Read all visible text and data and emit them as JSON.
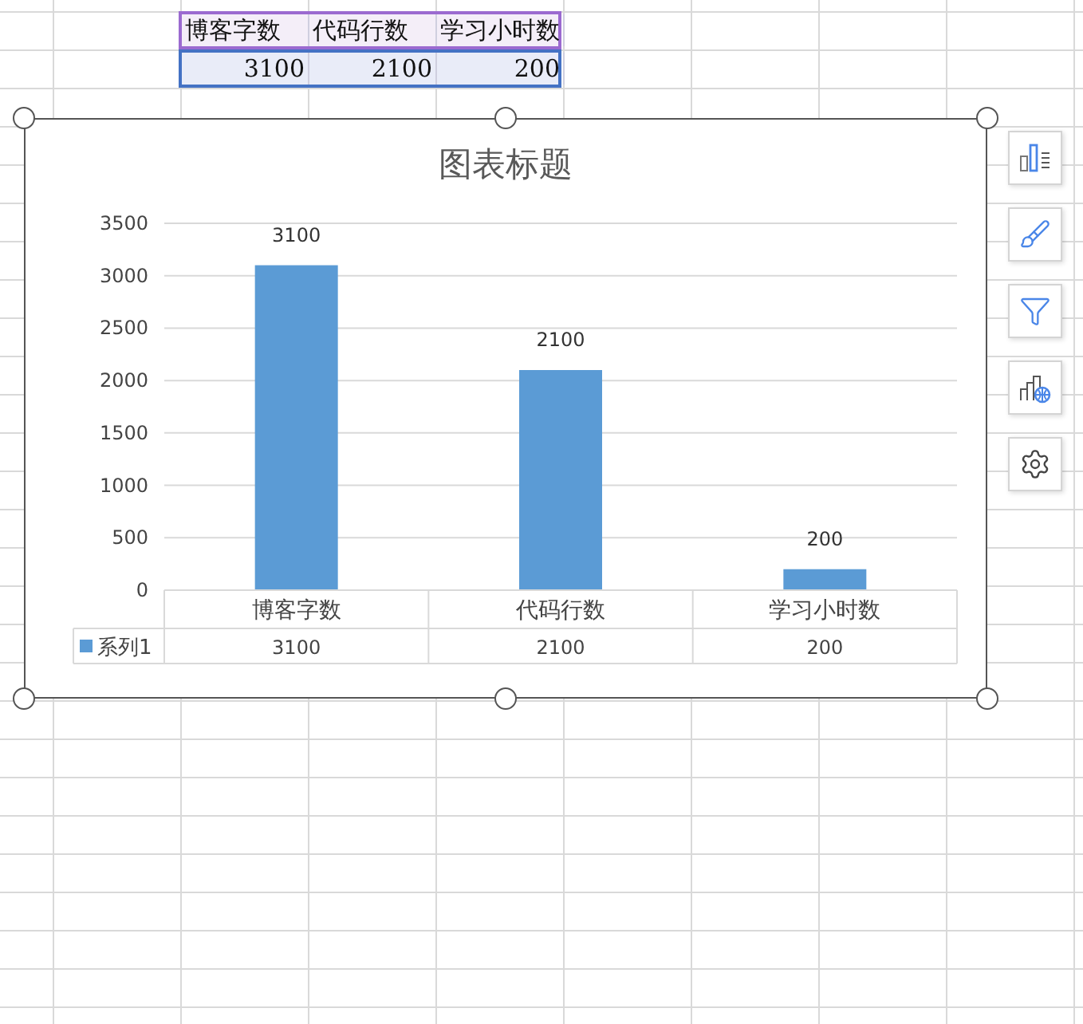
{
  "sheet": {
    "header_cells": [
      "博客字数",
      "代码行数",
      "学习小时数"
    ],
    "value_cells": [
      "3100",
      "2100",
      "200"
    ]
  },
  "chart": {
    "title": "图表标题",
    "chart_data": {
      "type": "bar",
      "categories": [
        "博客字数",
        "代码行数",
        "学习小时数"
      ],
      "series": [
        {
          "name": "系列1",
          "color": "#5b9bd5",
          "values": [
            3100,
            2100,
            200
          ]
        }
      ],
      "ylim": [
        0,
        3500
      ],
      "yticks": [
        0,
        500,
        1000,
        1500,
        2000,
        2500,
        3000,
        3500
      ],
      "grid": true,
      "value_labels": [
        "3100",
        "2100",
        "200"
      ]
    },
    "data_table": {
      "cells": [
        "3100",
        "2100",
        "200"
      ]
    }
  }
}
